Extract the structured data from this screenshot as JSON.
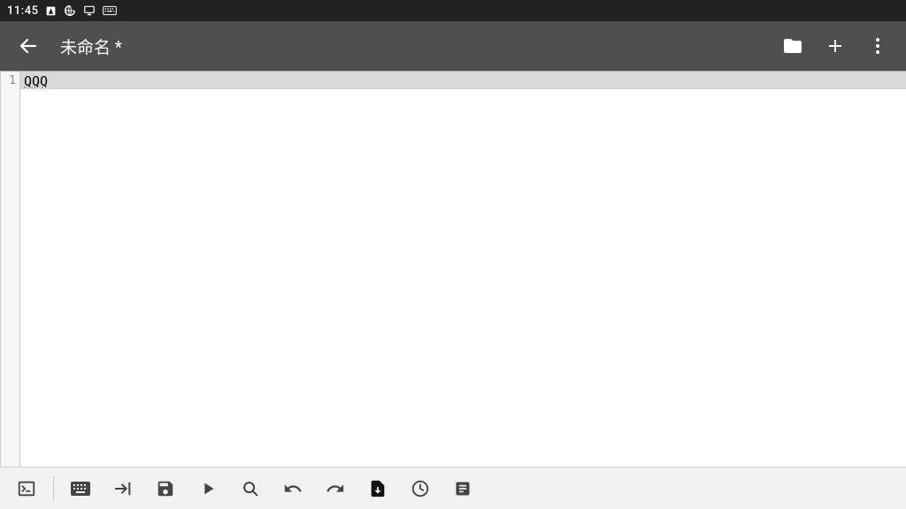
{
  "status_bar": {
    "time": "11:45"
  },
  "app_bar": {
    "title": "未命名 *"
  },
  "editor": {
    "lines": [
      {
        "num": "1",
        "text": "QQQ"
      }
    ]
  }
}
